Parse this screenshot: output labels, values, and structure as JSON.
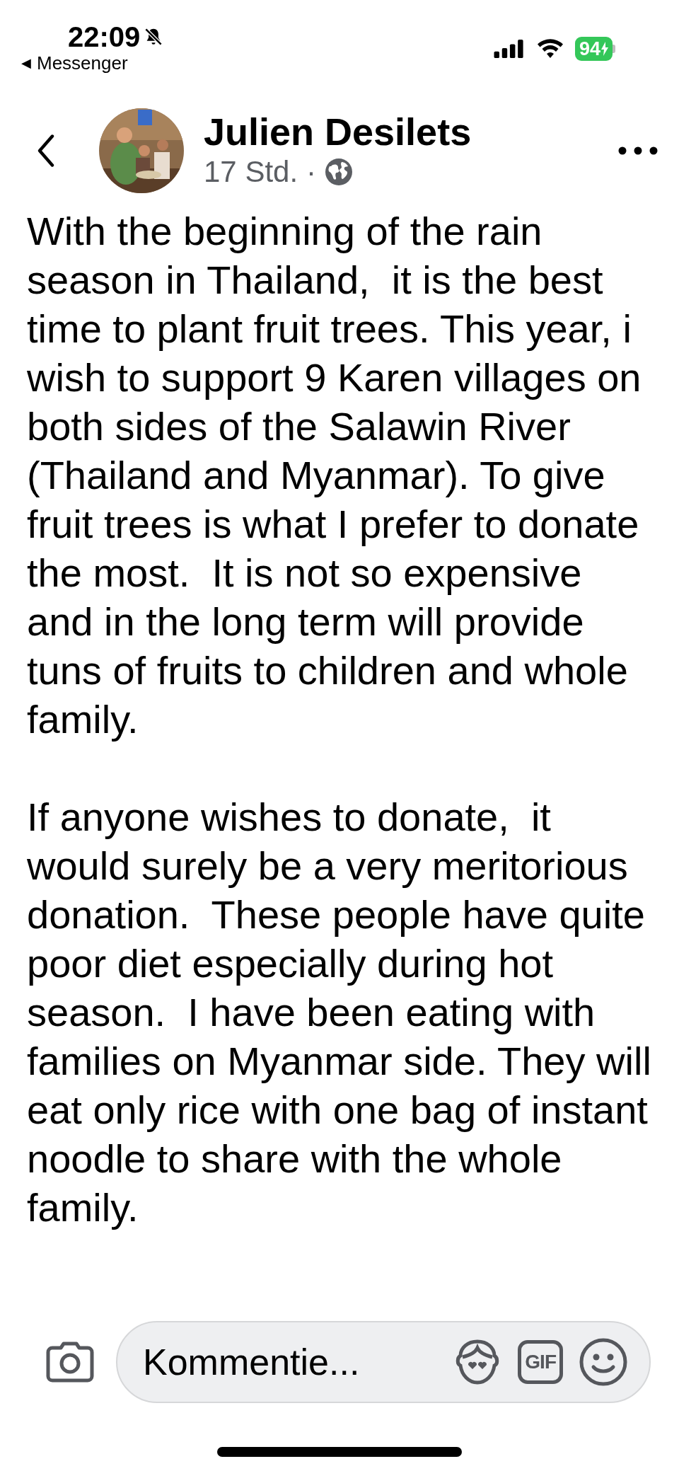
{
  "status_bar": {
    "time": "22:09",
    "muted": true,
    "back_app": "Messenger",
    "back_arrow": "◀",
    "battery": "94",
    "charging": true
  },
  "post": {
    "author": "Julien Desilets",
    "time": "17 Std.",
    "separator": "·",
    "paragraphs": [
      "With the beginning of the rain season in Thailand,  it is the best time to plant fruit trees. This year, i wish to support 9 Karen villages on both sides of the Salawin River (Thailand and Myanmar). To give fruit trees is what I prefer to donate the most.  It is not so expensive and in the long term will provide tuns of fruits to children and whole family.",
      "If anyone wishes to donate,  it would surely be a very meritorious donation.  These people have quite poor diet especially during hot season.  I have been eating with families on Myanmar side. They will eat only rice with one bag of instant noodle to share with the whole family."
    ]
  },
  "comment_bar": {
    "placeholder": "Kommentie...",
    "gif": "GIF"
  }
}
